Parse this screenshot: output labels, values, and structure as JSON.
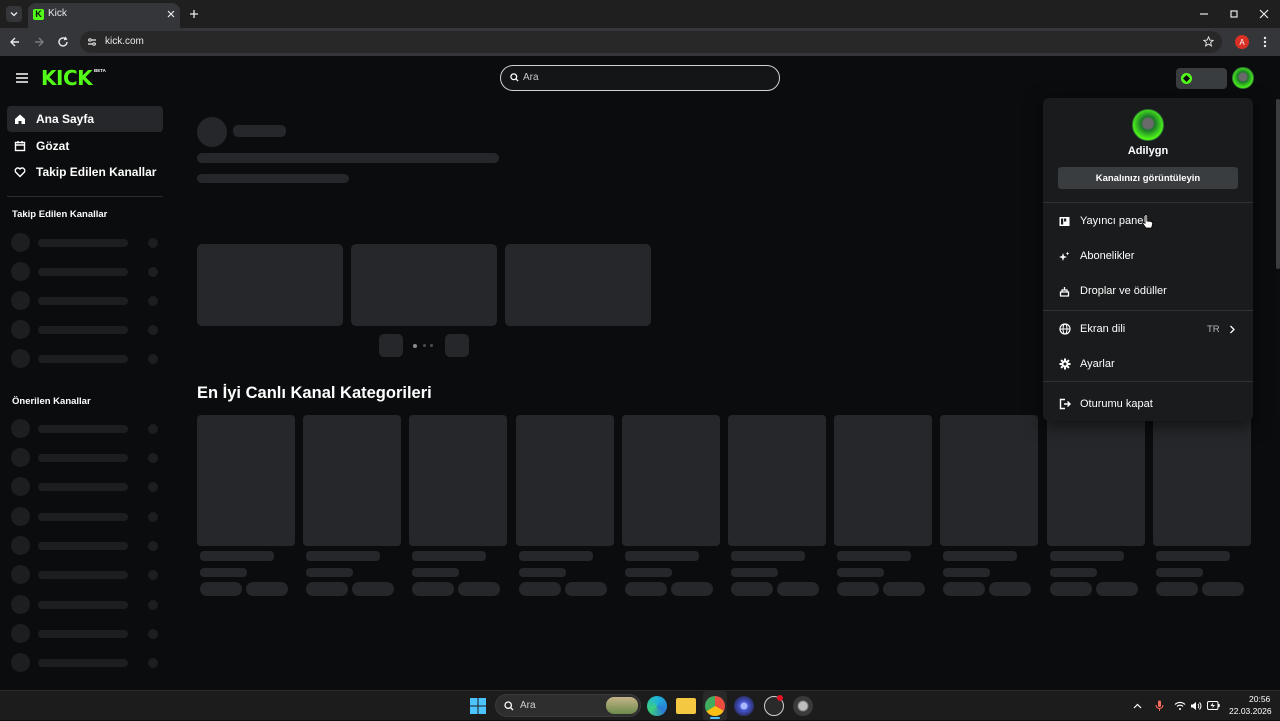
{
  "browser": {
    "tab_title": "Kick",
    "address": "kick.com",
    "profile_initial": "A"
  },
  "header": {
    "logo": "KICK",
    "logo_badge": "BETA",
    "search_placeholder": "Ara"
  },
  "sidebar": {
    "nav": [
      {
        "label": "Ana Sayfa",
        "icon": "home-icon"
      },
      {
        "label": "Gözat",
        "icon": "browse-icon"
      },
      {
        "label": "Takip Edilen Kanallar",
        "icon": "heart-icon"
      }
    ],
    "followed_heading": "Takip Edilen Kanallar",
    "recommended_heading": "Önerilen Kanallar"
  },
  "main": {
    "categories_heading": "En İyi Canlı Kanal Kategorileri"
  },
  "menu": {
    "username": "Adilygn",
    "view_channel": "Kanalınızı görüntüleyin",
    "items": [
      {
        "label": "Yayıncı paneli",
        "icon": "dashboard-icon"
      },
      {
        "label": "Abonelikler",
        "icon": "sparkle-icon"
      },
      {
        "label": "Droplar ve ödüller",
        "icon": "gift-icon"
      },
      {
        "label": "Ekran dili",
        "icon": "globe-icon",
        "value": "TR"
      },
      {
        "label": "Ayarlar",
        "icon": "gear-icon"
      },
      {
        "label": "Oturumu kapat",
        "icon": "logout-icon"
      }
    ]
  },
  "taskbar": {
    "search_placeholder": "Ara",
    "time": "20:56",
    "date": "22.03.2026"
  },
  "colors": {
    "kick_green": "#53fc18",
    "background": "#0b0c0d",
    "menu_bg": "#191b1c",
    "skeleton": "#25272a"
  }
}
